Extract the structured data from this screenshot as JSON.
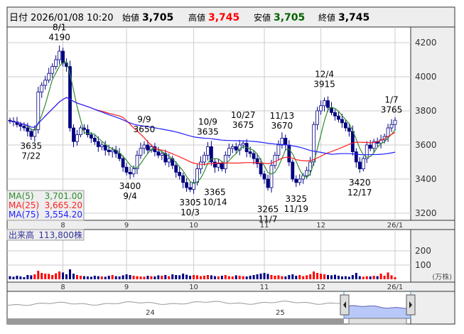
{
  "header": {
    "date_label": "日付",
    "datetime": "2026/01/08 10:20",
    "open_label": "始値",
    "open": "3,705",
    "high_label": "高値",
    "high": "3,745",
    "low_label": "安値",
    "low": "3,705",
    "close_label": "終値",
    "close": "3,745"
  },
  "legend": {
    "ma5_label": "MA(5)",
    "ma5": "3,701.00",
    "ma25_label": "MA(25)",
    "ma25": "3,665.20",
    "ma75_label": "MA(75)",
    "ma75": "3,554.20"
  },
  "volume_legend": {
    "label": "出来高",
    "value": "113,800株"
  },
  "volume_unit": "(万株)",
  "colors": {
    "up": "#ffffff",
    "down": "#000080",
    "vol_up": "#ff0000",
    "vol_down": "#000080",
    "ma5": "#2e8b2e",
    "ma25": "#ff2020",
    "ma75": "#2020ff",
    "nav_fill": "#b8c8f8"
  },
  "navigator": {
    "labels": [
      "24",
      "25"
    ]
  },
  "chart_data": {
    "type": "candlestick",
    "ylim": [
      3150,
      4300
    ],
    "y_ticks": [
      "3200",
      "3400",
      "3600",
      "3800",
      "4000",
      "4200"
    ],
    "y_tick_values": [
      3200,
      3400,
      3600,
      3800,
      4000,
      4200
    ],
    "vol_ticks": [
      "100",
      "200"
    ],
    "vol_tick_values": [
      100,
      200
    ],
    "month_labels": [
      {
        "label": "8",
        "index": 15
      },
      {
        "label": "9",
        "index": 33
      },
      {
        "label": "10",
        "index": 52
      },
      {
        "label": "11",
        "index": 72
      },
      {
        "label": "12",
        "index": 88
      },
      {
        "label": "26/1",
        "index": 109
      }
    ],
    "closes": [
      3740,
      3735,
      3720,
      3710,
      3700,
      3680,
      3650,
      3690,
      3910,
      3950,
      3980,
      4020,
      4060,
      4100,
      4150,
      4080,
      4060,
      3700,
      3620,
      3660,
      3700,
      3690,
      3660,
      3640,
      3620,
      3590,
      3600,
      3570,
      3560,
      3570,
      3550,
      3520,
      3470,
      3440,
      3430,
      3460,
      3540,
      3580,
      3600,
      3570,
      3590,
      3560,
      3540,
      3550,
      3500,
      3520,
      3480,
      3440,
      3420,
      3380,
      3350,
      3340,
      3380,
      3460,
      3500,
      3540,
      3590,
      3500,
      3470,
      3490,
      3460,
      3540,
      3580,
      3590,
      3570,
      3600,
      3610,
      3560,
      3550,
      3520,
      3490,
      3430,
      3400,
      3350,
      3480,
      3540,
      3600,
      3640,
      3600,
      3500,
      3400,
      3380,
      3400,
      3420,
      3450,
      3500,
      3720,
      3800,
      3830,
      3860,
      3820,
      3790,
      3770,
      3750,
      3730,
      3700,
      3680,
      3560,
      3500,
      3460,
      3520,
      3600,
      3580,
      3620,
      3610,
      3630,
      3650,
      3700,
      3720,
      3745
    ],
    "volumes": [
      22,
      18,
      25,
      20,
      15,
      30,
      28,
      35,
      60,
      45,
      40,
      38,
      30,
      42,
      55,
      48,
      35,
      70,
      40,
      30,
      25,
      22,
      20,
      18,
      25,
      22,
      20,
      18,
      25,
      30,
      22,
      20,
      28,
      35,
      30,
      25,
      22,
      20,
      18,
      25,
      22,
      20,
      28,
      25,
      30,
      22,
      35,
      30,
      28,
      40,
      32,
      25,
      30,
      28,
      22,
      25,
      30,
      28,
      22,
      20,
      25,
      30,
      22,
      20,
      28,
      25,
      22,
      20,
      25,
      30,
      35,
      40,
      45,
      38,
      30,
      25,
      28,
      22,
      20,
      30,
      35,
      25,
      30,
      22,
      28,
      35,
      55,
      45,
      40,
      35,
      30,
      28,
      32,
      25,
      20,
      22,
      18,
      30,
      45,
      22,
      18,
      22,
      20,
      25,
      22,
      40,
      25,
      48,
      28,
      15
    ],
    "annotations": [
      {
        "date": "8/1",
        "price": "4190",
        "index": 14,
        "pos": "above"
      },
      {
        "date": "7/22",
        "price": "3635",
        "index": 6,
        "pos": "below"
      },
      {
        "date": "9/4",
        "price": "3400",
        "index": 34,
        "pos": "below"
      },
      {
        "date": "9/9",
        "price": "3650",
        "index": 38,
        "pos": "above"
      },
      {
        "date": "10/3",
        "price": "3305",
        "index": 51,
        "pos": "below"
      },
      {
        "date": "10/9",
        "price": "3635",
        "index": 56,
        "pos": "above"
      },
      {
        "date": "10/14",
        "price": "3365",
        "index": 58,
        "pos": "below"
      },
      {
        "date": "10/27",
        "price": "3675",
        "index": 66,
        "pos": "above"
      },
      {
        "date": "11/7",
        "price": "3265",
        "index": 73,
        "pos": "below"
      },
      {
        "date": "11/13",
        "price": "3670",
        "index": 77,
        "pos": "above"
      },
      {
        "date": "11/19",
        "price": "3325",
        "index": 81,
        "pos": "below"
      },
      {
        "date": "12/4",
        "price": "3915",
        "index": 89,
        "pos": "above"
      },
      {
        "date": "12/17",
        "price": "3420",
        "index": 99,
        "pos": "below"
      },
      {
        "date": "1/7",
        "price": "3765",
        "index": 108,
        "pos": "above"
      }
    ]
  }
}
